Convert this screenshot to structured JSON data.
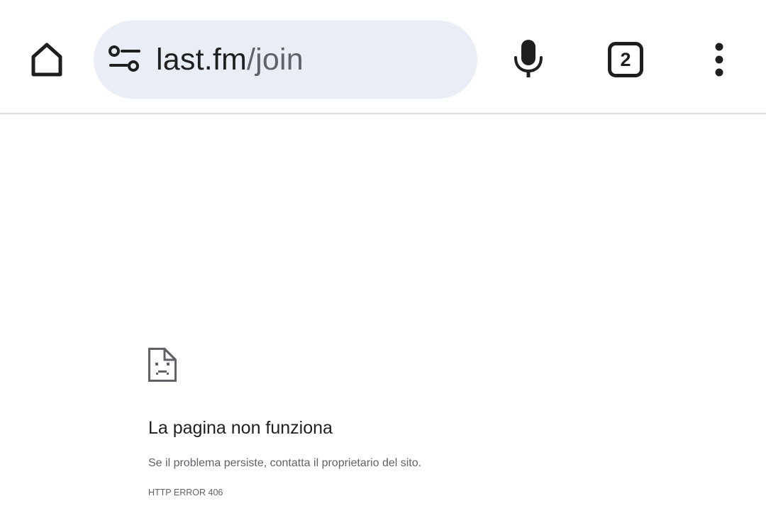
{
  "toolbar": {
    "home_icon": "home-icon",
    "omnibox": {
      "url_domain": "last.fm",
      "url_path": "/join",
      "site_info_icon": "tune-icon"
    },
    "mic_icon": "microphone-icon",
    "tab_count": "2",
    "menu_icon": "more-vert-icon"
  },
  "error_page": {
    "icon": "sad-page-icon",
    "title": "La pagina non funziona",
    "description": "Se il problema persiste, contatta il proprietario del sito.",
    "error_code": "HTTP ERROR 406"
  },
  "colors": {
    "omnibox_bg": "#e8edf6",
    "icon_color": "#1f1f1f",
    "text_secondary": "#5f6368"
  }
}
